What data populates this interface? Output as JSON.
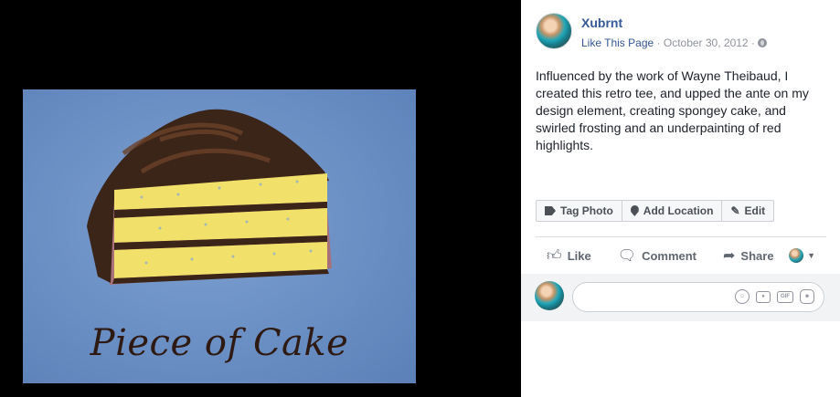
{
  "photo": {
    "caption": "Piece of Cake"
  },
  "post": {
    "author": "Xubrnt",
    "like_page": "Like This Page",
    "separator": "·",
    "date": "October 30, 2012",
    "text": "Influenced by the work of Wayne Theibaud, I created this retro tee, and upped the ante on my design element, creating spongey cake, and swirled frosting and an underpainting of red highlights."
  },
  "tag_bar": {
    "tag_photo": "Tag Photo",
    "add_location": "Add Location",
    "edit": "Edit"
  },
  "actions": {
    "like": "Like",
    "comment": "Comment",
    "share": "Share"
  },
  "comment": {
    "placeholder": ""
  },
  "colors": {
    "link": "#365899",
    "meta": "#90949c",
    "text": "#1d2129",
    "tshirt_blue": "#6a8fc4",
    "cake_yellow": "#f1e06a",
    "chocolate": "#3b2418"
  },
  "icons": [
    "globe-icon",
    "tag-icon",
    "pin-icon",
    "pencil-icon",
    "thumbs-up-icon",
    "comment-icon",
    "share-icon",
    "caret-down-icon",
    "emoji-icon",
    "camera-icon",
    "gif-icon",
    "sticker-icon"
  ]
}
